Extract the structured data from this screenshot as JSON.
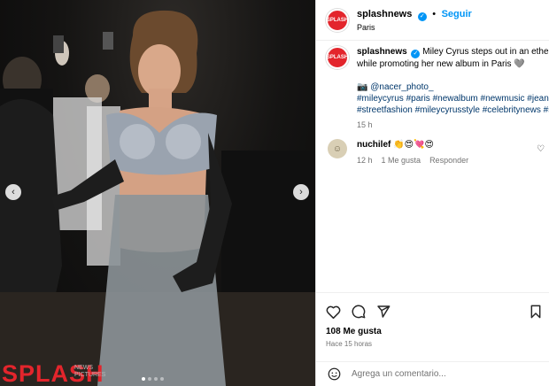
{
  "post": {
    "username": "splashnews",
    "follow_label": "Seguir",
    "separator": "•",
    "location": "Paris",
    "avatar_text": "SPLASH"
  },
  "caption": {
    "text": "Miley Cyrus steps out in an ethereal s",
    "text_line2": "while promoting her new album in Paris 🩶",
    "photo_credit": "📷 @nacer_photo_",
    "hashtags_line1": "#mileycyrus #paris #newalbum #newmusic #jeanpa",
    "hashtags_line2": "#streetfashion #mileycyrusstyle #celebritynews #spl",
    "time": "15 h"
  },
  "comment": {
    "username": "nuchilef",
    "text": "👏😍💘😍",
    "time": "12 h",
    "likes": "1 Me gusta",
    "reply": "Responder"
  },
  "actions": {
    "likes": "108 Me gusta",
    "posted_ago": "Hace 15 horas"
  },
  "composer": {
    "placeholder": "Agrega un comentario..."
  },
  "media": {
    "watermark": "SPLASH",
    "watermark_sub": "NEWS PICTURES"
  },
  "colors": {
    "accent": "#0095f6",
    "brand": "#e3252c",
    "link": "#00376b"
  },
  "icons": {
    "verified": "verified-badge-icon",
    "like": "heart-icon",
    "comment": "comment-icon",
    "share": "share-icon",
    "save": "bookmark-icon",
    "emoji": "emoji-icon",
    "prev": "chevron-left-icon",
    "next": "chevron-right-icon"
  }
}
